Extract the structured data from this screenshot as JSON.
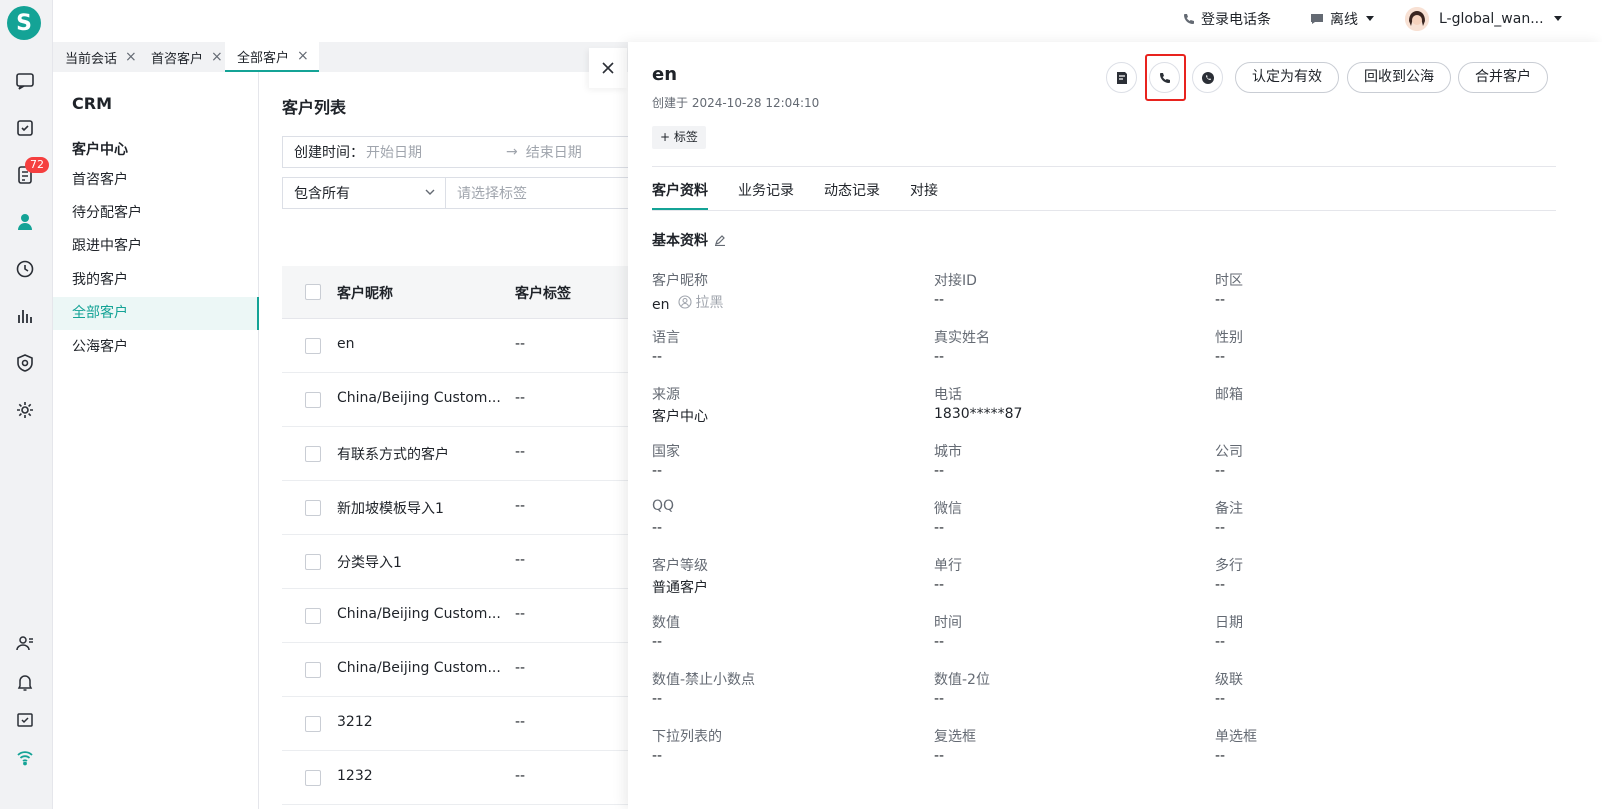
{
  "rail": {
    "logo": "S",
    "badge": "72"
  },
  "topbar": {
    "login_phone": "登录电话条",
    "status": "离线",
    "user": "L-global_wan..."
  },
  "tabs": [
    {
      "label": "当前会话"
    },
    {
      "label": "首咨客户"
    },
    {
      "label": "全部客户"
    }
  ],
  "crm": {
    "title": "CRM",
    "group": "客户中心",
    "items": [
      "首咨客户",
      "待分配客户",
      "跟进中客户",
      "我的客户",
      "全部客户",
      "公海客户"
    ]
  },
  "list": {
    "title": "客户列表",
    "filter_created_label": "创建时间：",
    "start_placeholder": "开始日期",
    "arrow": "→",
    "end_placeholder": "结束日期",
    "select_value": "包含所有",
    "tag_placeholder": "请选择标签",
    "col_name": "客户昵称",
    "col_tag": "客户标签",
    "rows": [
      {
        "name": "en",
        "tag": "--"
      },
      {
        "name": "China/Beijing Custom...",
        "tag": "--"
      },
      {
        "name": "有联系方式的客户",
        "tag": "--"
      },
      {
        "name": "新加坡模板导入1",
        "tag": "--"
      },
      {
        "name": "分类导入1",
        "tag": "--"
      },
      {
        "name": "China/Beijing Custom...",
        "tag": "--"
      },
      {
        "name": "China/Beijing Custom...",
        "tag": "--"
      },
      {
        "name": "3212",
        "tag": "--"
      },
      {
        "name": "1232",
        "tag": "--"
      }
    ]
  },
  "drawer": {
    "name": "en",
    "created": "创建于 2024-10-28 12:04:10",
    "tag_button": "+ 标签",
    "actions": {
      "mark_valid": "认定为有效",
      "recycle": "回收到公海",
      "merge": "合并客户"
    },
    "tabs": [
      "客户资料",
      "业务记录",
      "动态记录",
      "对接"
    ],
    "section": "基本资料",
    "blacklist": "拉黑",
    "fields": [
      {
        "label": "客户昵称",
        "value": "en"
      },
      {
        "label": "对接ID",
        "value": "--"
      },
      {
        "label": "时区",
        "value": "--"
      },
      {
        "label": "语言",
        "value": "--"
      },
      {
        "label": "真实姓名",
        "value": "--"
      },
      {
        "label": "性别",
        "value": "--"
      },
      {
        "label": "来源",
        "value": "客户中心"
      },
      {
        "label": "电话",
        "value": "1830*****87"
      },
      {
        "label": "邮箱",
        "value": ""
      },
      {
        "label": "国家",
        "value": "--"
      },
      {
        "label": "城市",
        "value": "--"
      },
      {
        "label": "公司",
        "value": "--"
      },
      {
        "label": "QQ",
        "value": "--"
      },
      {
        "label": "微信",
        "value": "--"
      },
      {
        "label": "备注",
        "value": "--"
      },
      {
        "label": "客户等级",
        "value": "普通客户"
      },
      {
        "label": "单行",
        "value": "--"
      },
      {
        "label": "多行",
        "value": "--"
      },
      {
        "label": "数值",
        "value": "--"
      },
      {
        "label": "时间",
        "value": "--"
      },
      {
        "label": "日期",
        "value": "--"
      },
      {
        "label": "数值-禁止小数点",
        "value": "--"
      },
      {
        "label": "数值-2位",
        "value": "--"
      },
      {
        "label": "级联",
        "value": "--"
      },
      {
        "label": "下拉列表的",
        "value": "--"
      },
      {
        "label": "复选框",
        "value": "--"
      },
      {
        "label": "单选框",
        "value": "--"
      }
    ]
  },
  "colors": {
    "accent": "#14a396",
    "badge": "#f53f3f",
    "highlight": "#e8231e"
  }
}
